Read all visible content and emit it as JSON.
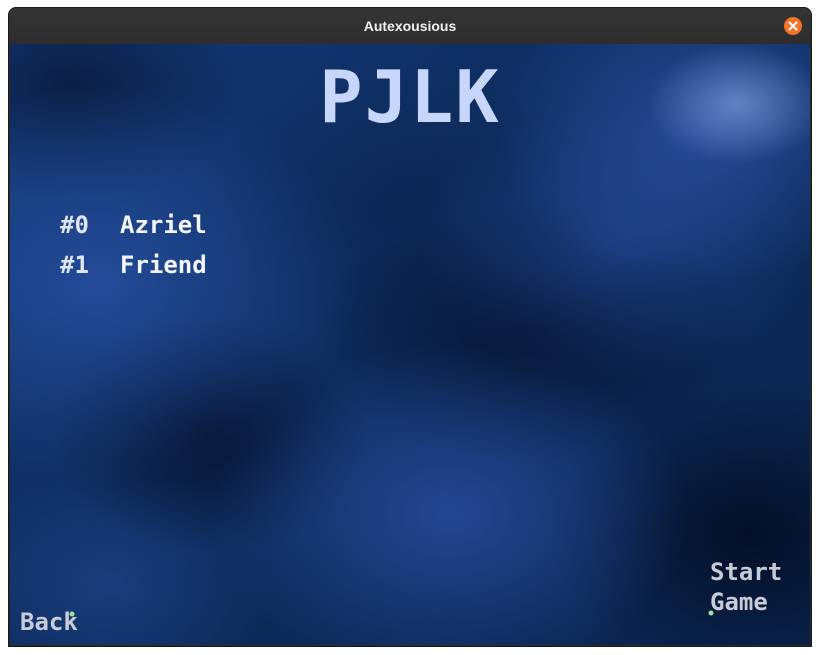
{
  "window": {
    "title": "Autexousious",
    "close_icon": "close-icon",
    "close_color": "#f37329"
  },
  "game": {
    "title": "PJLK",
    "title_color": "#c9d6fb",
    "background": "blue-nebula"
  },
  "players": [
    {
      "index": "#0",
      "name": "Azriel"
    },
    {
      "index": "#1",
      "name": "Friend"
    }
  ],
  "buttons": {
    "back_label": "Back",
    "start_label": "Start\nGame"
  },
  "cursor_icon": "cursor-dot-icon"
}
